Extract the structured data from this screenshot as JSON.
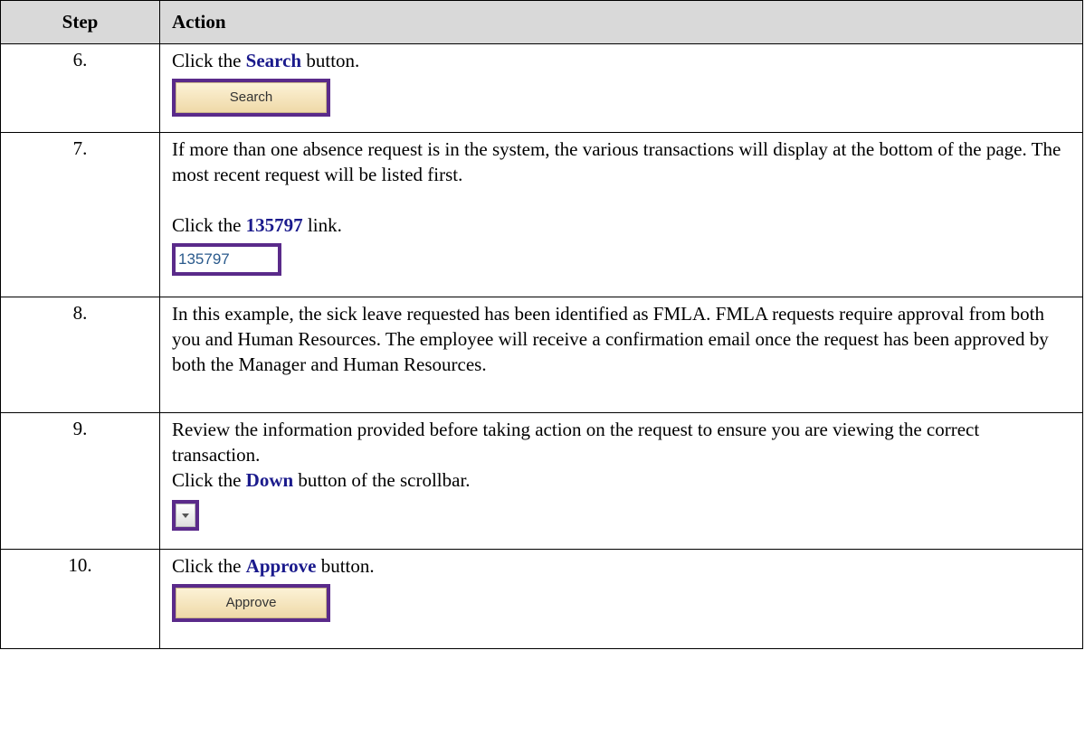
{
  "table": {
    "headers": {
      "step": "Step",
      "action": "Action"
    },
    "rows": [
      {
        "step": "6.",
        "pre": "Click the ",
        "keyword": "Search",
        "post": " button.",
        "image_label": "Search"
      },
      {
        "step": "7.",
        "intro": "If more than one absence request is in the system, the various transactions will display at the bottom of the page. The most recent request will be listed first.",
        "pre": "Click the ",
        "keyword": "135797",
        "post": " link.",
        "image_label": "135797"
      },
      {
        "step": "8.",
        "text": "In this example, the sick leave requested has been identified as FMLA. FMLA requests require approval from both you and Human Resources. The employee will receive a confirmation email once the request has been approved by both the Manager and Human Resources."
      },
      {
        "step": "9.",
        "intro": "Review the information provided before taking action on the request to ensure you are viewing the correct transaction.",
        "pre": "Click the ",
        "keyword": "Down",
        "post": " button of the scrollbar.",
        "image_icon": "scroll-down-arrow-icon"
      },
      {
        "step": "10.",
        "pre": "Click the ",
        "keyword": "Approve",
        "post": " button.",
        "image_label": "Approve"
      }
    ]
  },
  "colors": {
    "keyword": "#1a1a8c",
    "header_bg": "#d9d9d9",
    "image_border": "#5a2a8a",
    "button_face": "#f3e2b8",
    "link_text": "#2a5a8c"
  }
}
